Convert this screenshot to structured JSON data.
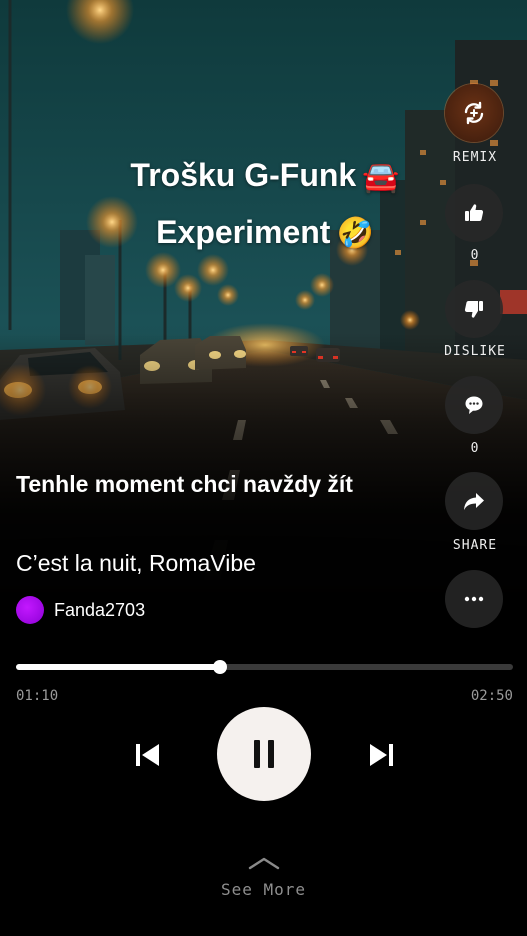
{
  "header": {
    "title_line1": "Trošku G-Funk",
    "title_emoji1": "🚘",
    "title_line2": "Experiment",
    "title_emoji2": "🤣"
  },
  "actions": {
    "remix_label": "REMIX",
    "like_count": "0",
    "dislike_label": "DISLIKE",
    "comment_count": "0",
    "share_label": "SHARE"
  },
  "song": {
    "title": "Tenhle moment chci navždy žít",
    "artists": "C’est la nuit, RomaVibe",
    "user": "Fanda2703"
  },
  "player": {
    "elapsed": "01:10",
    "duration": "02:50",
    "progress": 0.41
  },
  "footer": {
    "see_more": "See More"
  },
  "colors": {
    "accent_remix": "#5a2a12",
    "avatar": "#b010f0",
    "play_button": "#f5f1ee"
  }
}
